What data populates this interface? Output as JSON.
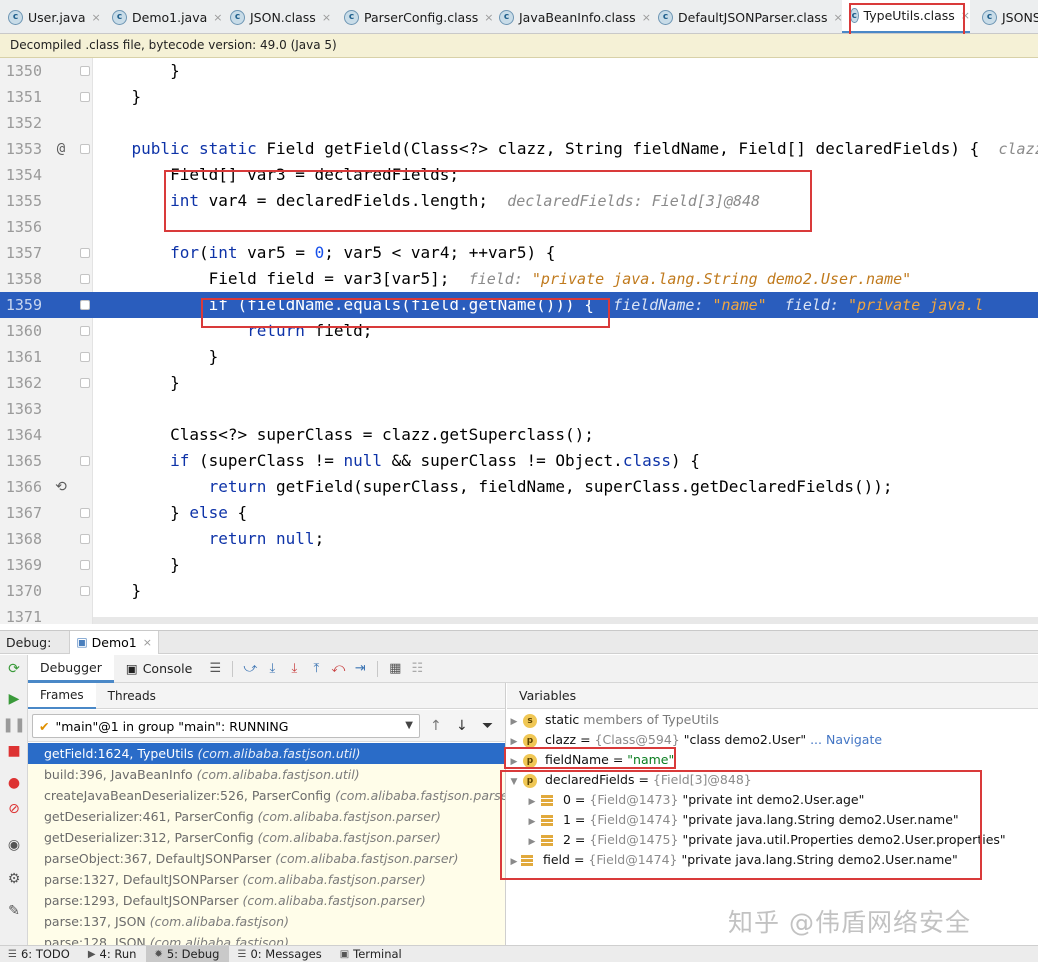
{
  "tabs": [
    {
      "label": "User.java",
      "icon": "class-c-icon",
      "left": 0
    },
    {
      "label": "Demo1.java",
      "icon": "class-c-icon"
    },
    {
      "label": "JSON.class",
      "icon": "class-c-icon"
    },
    {
      "label": "ParserConfig.class",
      "icon": "class-c-icon"
    },
    {
      "label": "JavaBeanInfo.class",
      "icon": "class-c-icon"
    },
    {
      "label": "DefaultJSONParser.class",
      "icon": "class-c-icon"
    },
    {
      "label": "TypeUtils.class",
      "icon": "class-c-icon",
      "active": true
    },
    {
      "label": "JSONS",
      "icon": "class-c-icon"
    }
  ],
  "tab_icon_letter": "c",
  "tab_close": "×",
  "info_bar": "Decompiled .class file, bytecode version: 49.0 (Java 5)",
  "editor": {
    "lines": [
      {
        "n": "1350",
        "text": "        }"
      },
      {
        "n": "1351",
        "text": "    }"
      },
      {
        "n": "1352",
        "text": ""
      },
      {
        "n": "1353",
        "mark": "@",
        "text": "    public static Field getField(Class<?> clazz, String fieldName, Field[] declaredFields) {  clazz: \"cla"
      },
      {
        "n": "1354",
        "text": "        Field[] var3 = declaredFields;"
      },
      {
        "n": "1355",
        "text": "        int var4 = declaredFields.length;  declaredFields: Field[3]@848"
      },
      {
        "n": "1356",
        "text": ""
      },
      {
        "n": "1357",
        "text": "        for(int var5 = 0; var5 < var4; ++var5) {"
      },
      {
        "n": "1358",
        "text": "            Field field = var3[var5];  field: \"private java.lang.String demo2.User.name\""
      },
      {
        "n": "1359",
        "text": "            if (fieldName.equals(field.getName())) {  fieldName: \"name\"  field: \"private java.l",
        "highlight": true
      },
      {
        "n": "1360",
        "text": "                return field;"
      },
      {
        "n": "1361",
        "text": "            }"
      },
      {
        "n": "1362",
        "text": "        }"
      },
      {
        "n": "1363",
        "text": ""
      },
      {
        "n": "1364",
        "text": "        Class<?> superClass = clazz.getSuperclass();"
      },
      {
        "n": "1365",
        "text": "        if (superClass != null && superClass != Object.class) {"
      },
      {
        "n": "1366",
        "mark": "⟲",
        "text": "            return getField(superClass, fieldName, superClass.getDeclaredFields());"
      },
      {
        "n": "1367",
        "text": "        } else {"
      },
      {
        "n": "1368",
        "text": "            return null;"
      },
      {
        "n": "1369",
        "text": "        }"
      },
      {
        "n": "1370",
        "text": "    }"
      },
      {
        "n": "1371",
        "text": ""
      }
    ]
  },
  "debug": {
    "label": "Debug:",
    "session_tab": "Demo1",
    "tabs": {
      "debugger": "Debugger",
      "console": "Console"
    },
    "frames_tab": "Frames",
    "threads_tab": "Threads",
    "thread_select": "\"main\"@1 in group \"main\": RUNNING",
    "variables_header": "Variables",
    "frames": [
      {
        "method": "getField:1624, TypeUtils",
        "pkg": "(com.alibaba.fastjson.util)",
        "selected": true
      },
      {
        "method": "build:396, JavaBeanInfo",
        "pkg": "(com.alibaba.fastjson.util)"
      },
      {
        "method": "createJavaBeanDeserializer:526, ParserConfig",
        "pkg": "(com.alibaba.fastjson.parser)"
      },
      {
        "method": "getDeserializer:461, ParserConfig",
        "pkg": "(com.alibaba.fastjson.parser)"
      },
      {
        "method": "getDeserializer:312, ParserConfig",
        "pkg": "(com.alibaba.fastjson.parser)"
      },
      {
        "method": "parseObject:367, DefaultJSONParser",
        "pkg": "(com.alibaba.fastjson.parser)"
      },
      {
        "method": "parse:1327, DefaultJSONParser",
        "pkg": "(com.alibaba.fastjson.parser)"
      },
      {
        "method": "parse:1293, DefaultJSONParser",
        "pkg": "(com.alibaba.fastjson.parser)"
      },
      {
        "method": "parse:137, JSON",
        "pkg": "(com.alibaba.fastjson)"
      },
      {
        "method": "parse:128, JSON",
        "pkg": "(com.alibaba.fastjson)"
      }
    ],
    "variables": {
      "static_kw": "static",
      "static_rest": "members of TypeUtils",
      "clazz_name": "clazz",
      "clazz_type": "{Class@594}",
      "clazz_value": "\"class demo2.User\"",
      "clazz_nav": "... Navigate",
      "fieldName_name": "fieldName",
      "fieldName_value": "\"name\"",
      "declared_name": "declaredFields",
      "declared_type": "{Field[3]@848}",
      "el0_idx": "0",
      "el0_type": "{Field@1473}",
      "el0_value": "\"private int demo2.User.age\"",
      "el1_idx": "1",
      "el1_type": "{Field@1474}",
      "el1_value": "\"private java.lang.String demo2.User.name\"",
      "el2_idx": "2",
      "el2_type": "{Field@1475}",
      "el2_value": "\"private java.util.Properties demo2.User.properties\"",
      "field_name": "field",
      "field_type": "{Field@1474}",
      "field_value": "\"private java.lang.String demo2.User.name\"",
      "eq": "=",
      "badge": "p",
      "sbadge": "s"
    }
  },
  "watermark": "知乎 @伟盾网络安全",
  "statusbar": [
    {
      "label": "6: TODO"
    },
    {
      "label": "4: Run"
    },
    {
      "label": "5: Debug",
      "active": true
    },
    {
      "label": "0: Messages"
    },
    {
      "label": "Terminal"
    }
  ],
  "colors": {
    "highlight": "#2a5dbd",
    "annotation_red": "#d93a3a",
    "keyword": "#0e33a8"
  }
}
